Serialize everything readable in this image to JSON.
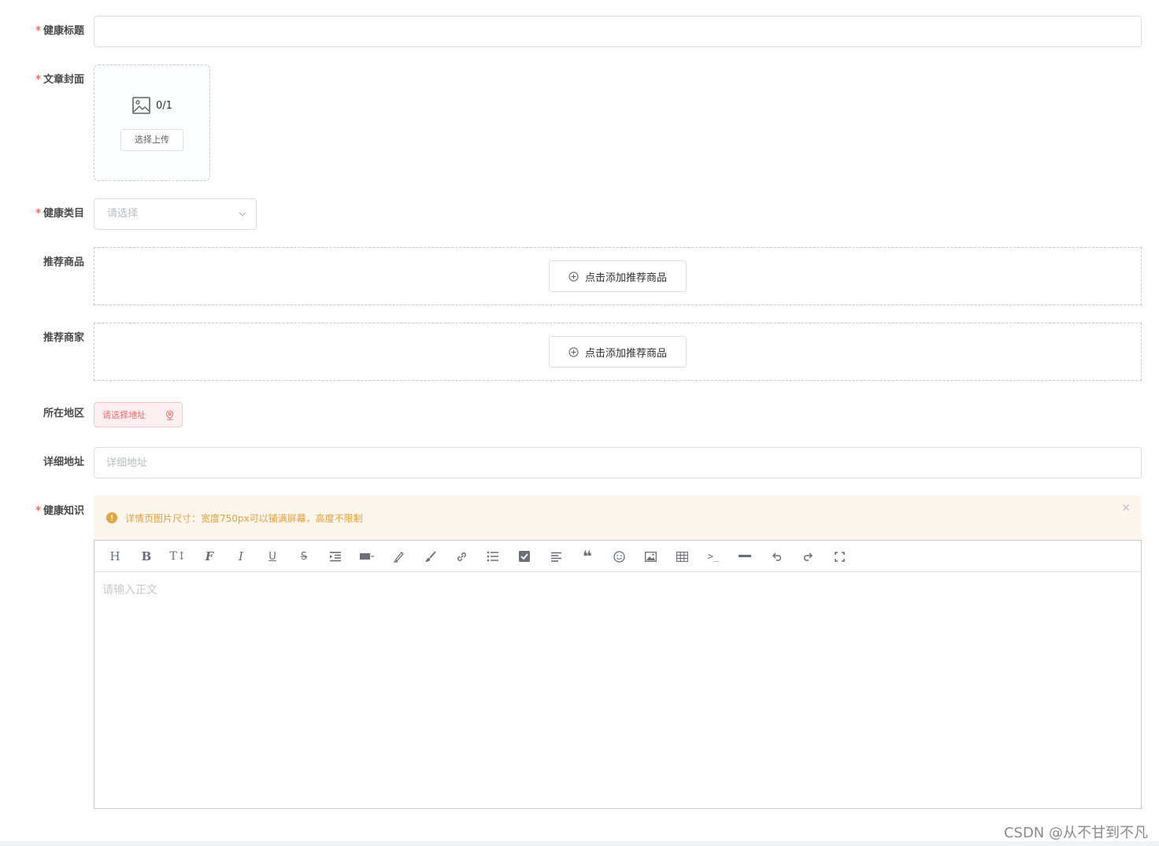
{
  "form": {
    "title": {
      "label": "健康标题",
      "required": true,
      "value": "",
      "placeholder": ""
    },
    "cover": {
      "label": "文章封面",
      "required": true,
      "count": "0/1",
      "upload_label": "选择上传"
    },
    "category": {
      "label": "健康类目",
      "required": true,
      "placeholder": "请选择"
    },
    "products": {
      "label": "推荐商品",
      "required": false,
      "button_label": "点击添加推荐商品"
    },
    "merchants": {
      "label": "推荐商家",
      "required": false,
      "button_label": "点击添加推荐商品"
    },
    "region": {
      "label": "所在地区",
      "required": false,
      "button_label": "请选择地址"
    },
    "address": {
      "label": "详细地址",
      "required": false,
      "placeholder": "详细地址"
    },
    "knowledge": {
      "label": "健康知识",
      "required": true,
      "alert_text": "详情页图片尺寸：宽度750px可以铺满屏幕，高度不限制",
      "editor_placeholder": "请输入正文",
      "toolbar": [
        "heading",
        "bold",
        "font-size",
        "font-family",
        "italic",
        "underline",
        "strikethrough",
        "indent",
        "align",
        "highlight",
        "brush",
        "link",
        "unordered-list",
        "checklist",
        "paragraph-align",
        "blockquote",
        "emoji",
        "image",
        "table",
        "code",
        "horizontal-rule",
        "undo",
        "redo",
        "fullscreen"
      ]
    }
  },
  "required_mark": "*",
  "watermark": "CSDN @从不甘到不凡",
  "colors": {
    "required": "#f56c6c",
    "warning": "#e6a23c",
    "warning_bg": "#fdf6ec",
    "danger_bg": "#fef0f0"
  }
}
